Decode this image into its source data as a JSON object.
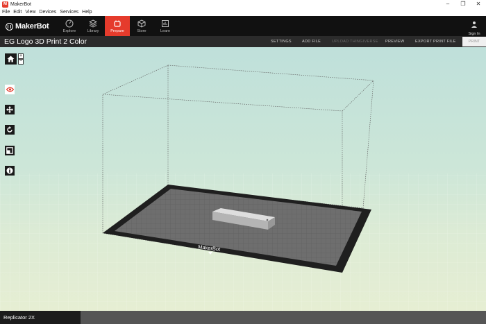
{
  "window": {
    "title": "MakerBot",
    "app_icon_glyph": "M"
  },
  "menu": [
    "File",
    "Edit",
    "View",
    "Devices",
    "Services",
    "Help"
  ],
  "nav": {
    "logo_text": "MakerBot",
    "tabs": [
      {
        "label": "Explore",
        "icon": "compass-icon"
      },
      {
        "label": "Library",
        "icon": "library-icon"
      },
      {
        "label": "Prepare",
        "icon": "prepare-icon",
        "active": true
      },
      {
        "label": "Store",
        "icon": "store-icon"
      },
      {
        "label": "Learn",
        "icon": "learn-icon"
      }
    ],
    "signin_label": "Sign In"
  },
  "project": {
    "title": "EG Logo 3D Print 2 Color",
    "actions": [
      {
        "label": "SETTINGS",
        "enabled": true
      },
      {
        "label": "ADD FILE",
        "enabled": true
      },
      {
        "label": "UPLOAD THINGIVERSE",
        "enabled": false
      },
      {
        "label": "PREVIEW",
        "enabled": true
      },
      {
        "label": "EXPORT PRINT FILE",
        "enabled": true
      }
    ],
    "print_label": "PRINT"
  },
  "viewport": {
    "bed_logo_text": "MakerBot",
    "zoom_in": "+",
    "zoom_out": "−",
    "tools": [
      "view-icon",
      "move-icon",
      "rotate-icon",
      "scale-icon",
      "info-icon"
    ],
    "active_tool": "view-icon"
  },
  "status": {
    "machine": "Replicator 2X"
  },
  "colors": {
    "accent": "#e53b2c",
    "nav_bg": "#111111",
    "subheader_bg": "#2b2b2b"
  }
}
